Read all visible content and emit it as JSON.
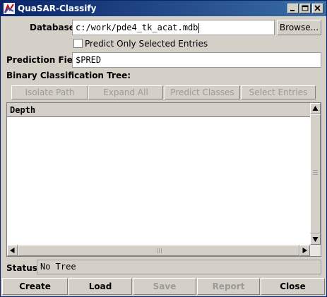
{
  "window": {
    "title": "QuaSAR-Classify"
  },
  "database": {
    "label": "Database:",
    "value": "c:/work/pde4_tk_acat.mdb",
    "browse_label": "Browse..."
  },
  "predict_only": {
    "label": "Predict Only Selected Entries",
    "checked": false
  },
  "prediction_field": {
    "label": "Prediction Field:",
    "value": "$PRED"
  },
  "tree": {
    "label": "Binary Classification Tree:",
    "column_header": "Depth"
  },
  "tree_actions": [
    {
      "label": "Isolate Path",
      "enabled": false
    },
    {
      "label": "Expand All",
      "enabled": false
    },
    {
      "label": "Predict Classes",
      "enabled": false
    },
    {
      "label": "Select Entries",
      "enabled": false
    }
  ],
  "status": {
    "label": "Status:",
    "value": "No Tree"
  },
  "footer_buttons": [
    {
      "label": "Create",
      "enabled": true
    },
    {
      "label": "Load",
      "enabled": true
    },
    {
      "label": "Save",
      "enabled": false
    },
    {
      "label": "Report",
      "enabled": false
    },
    {
      "label": "Close",
      "enabled": true
    }
  ],
  "colors": {
    "titlebar": "#0a246a",
    "panel": "#d4d0c8",
    "disabled_text": "#9a9a9a"
  }
}
